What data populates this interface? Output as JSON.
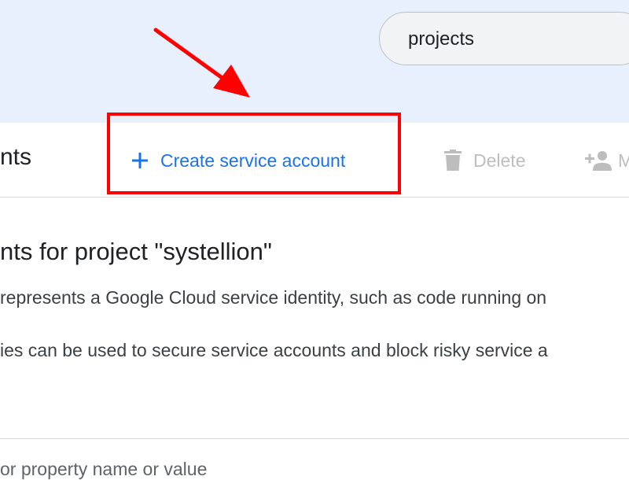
{
  "search": {
    "value": "projects"
  },
  "toolbar": {
    "page_title_fragment": "nts",
    "create_label": "Create service account",
    "delete_label": "Delete",
    "manage_label_fragment": "M"
  },
  "content": {
    "heading_fragment": "nts for project \"systellion\"",
    "description_line_1": " represents a Google Cloud service identity, such as code running on",
    "description_line_2": "ies can be used to secure service accounts and block risky service a"
  },
  "filter": {
    "placeholder_fragment": "or property name or value"
  },
  "annotation": {
    "highlight_color": "#ff0000",
    "arrow_color": "#ff0000"
  },
  "colors": {
    "accent": "#1a73e8",
    "disabled": "#bdbdbd",
    "band": "#e8f0fe"
  }
}
